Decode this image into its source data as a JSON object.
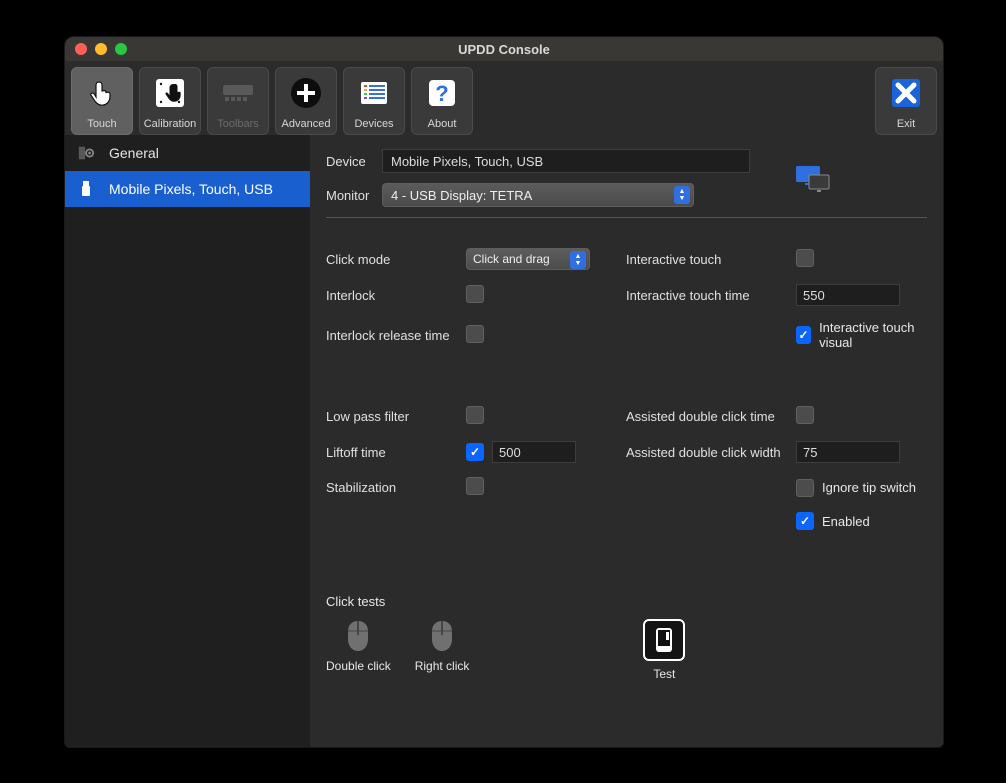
{
  "title": "UPDD Console",
  "toolbar": {
    "touch": "Touch",
    "calibration": "Calibration",
    "toolbars": "Toolbars",
    "advanced": "Advanced",
    "devices": "Devices",
    "about": "About",
    "exit": "Exit"
  },
  "sidebar": {
    "general": "General",
    "device": "Mobile Pixels, Touch, USB"
  },
  "header": {
    "device_label": "Device",
    "device_value": "Mobile Pixels, Touch, USB",
    "monitor_label": "Monitor",
    "monitor_value": "4 - USB Display: TETRA"
  },
  "settings": {
    "click_mode_label": "Click mode",
    "click_mode_value": "Click and drag",
    "interlock_label": "Interlock",
    "interlock_release_label": "Interlock release time",
    "interactive_touch_label": "Interactive touch",
    "interactive_touch_time_label": "Interactive touch time",
    "interactive_touch_time_value": "550",
    "interactive_touch_visual_label": "Interactive touch visual",
    "low_pass_label": "Low pass filter",
    "liftoff_label": "Liftoff time",
    "liftoff_value": "500",
    "stabilization_label": "Stabilization",
    "assisted_dc_time_label": "Assisted double click time",
    "assisted_dc_width_label": "Assisted double click width",
    "assisted_dc_width_value": "75",
    "ignore_tip_label": "Ignore tip switch",
    "enabled_label": "Enabled"
  },
  "tests": {
    "heading": "Click tests",
    "double": "Double click",
    "right": "Right click",
    "test": "Test"
  }
}
